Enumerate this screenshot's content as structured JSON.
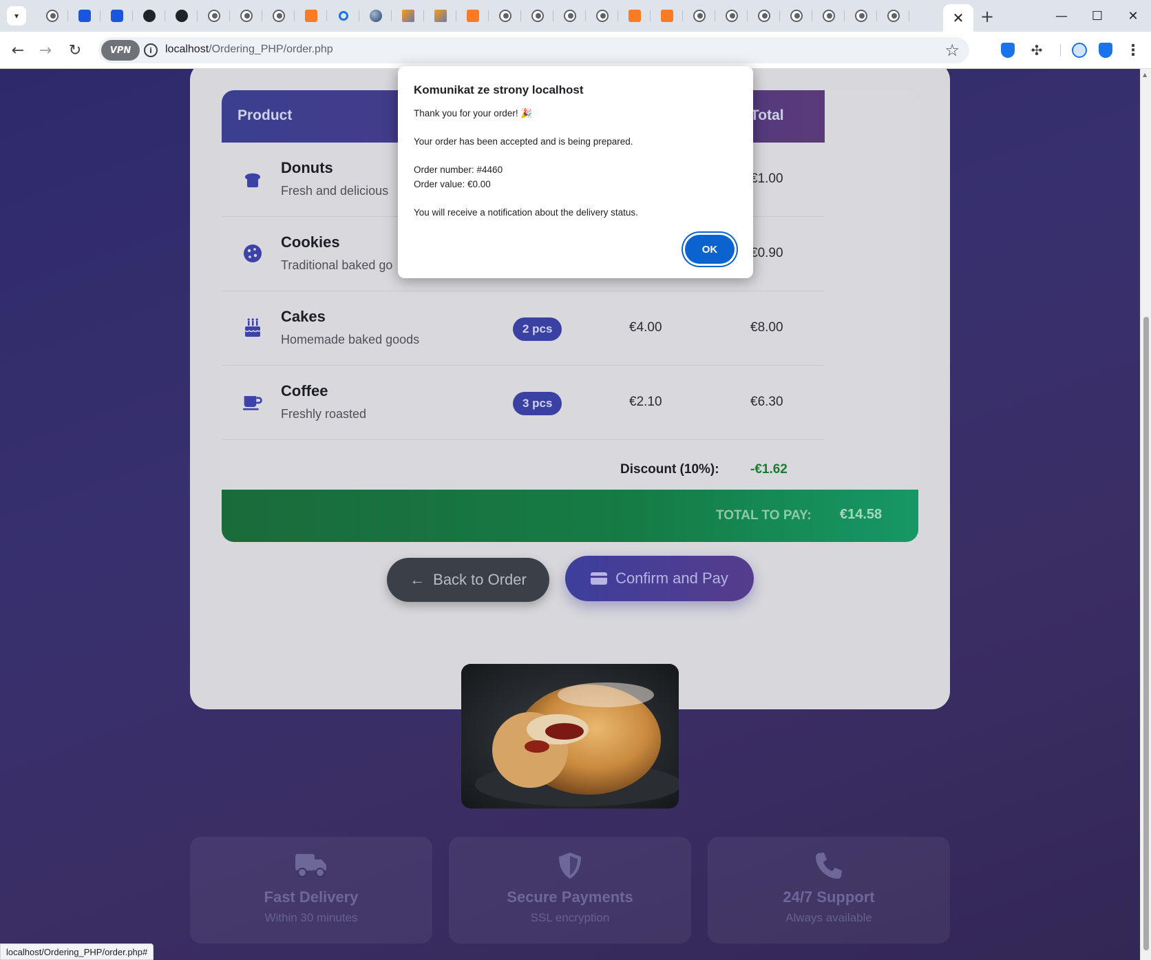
{
  "browser": {
    "url_host": "localhost",
    "url_path": "/Ordering_PHP/order.php",
    "vpn_label": "VPN",
    "status_url": "localhost/Ordering_PHP/order.php#"
  },
  "table": {
    "headers": {
      "product": "Product",
      "total": "Total"
    },
    "rows": [
      {
        "name": "Donuts",
        "desc": "Fresh and delicious",
        "qty": "",
        "price": "",
        "total": "€1.00",
        "icon": "bread-icon"
      },
      {
        "name": "Cookies",
        "desc": "Traditional baked go",
        "qty": "",
        "price": "",
        "total": "€0.90",
        "icon": "cookie-icon"
      },
      {
        "name": "Cakes",
        "desc": "Homemade baked goods",
        "qty": "2 pcs",
        "price": "€4.00",
        "total": "€8.00",
        "icon": "birthday-cake-icon"
      },
      {
        "name": "Coffee",
        "desc": "Freshly roasted",
        "qty": "3 pcs",
        "price": "€2.10",
        "total": "€6.30",
        "icon": "coffee-cup-icon"
      }
    ],
    "discount_label": "Discount (10%):",
    "discount_value": "-€1.62",
    "total_label": "TOTAL TO PAY:",
    "total_value": "€14.58"
  },
  "actions": {
    "back_label": "Back to Order",
    "pay_label": "Confirm and Pay"
  },
  "features": [
    {
      "title": "Fast Delivery",
      "sub": "Within 30 minutes",
      "icon": "truck-icon"
    },
    {
      "title": "Secure Payments",
      "sub": "SSL encryption",
      "icon": "shield-icon"
    },
    {
      "title": "24/7 Support",
      "sub": "Always available",
      "icon": "phone-icon"
    }
  ],
  "dialog": {
    "title": "Komunikat ze strony localhost",
    "line1": "Thank you for your order! 🎉",
    "line2": "Your order has been accepted and is being prepared.",
    "line3": "Order number: #4460",
    "line4": "Order value: €0.00",
    "line5": "You will receive a notification about the delivery status.",
    "ok_label": "OK"
  },
  "colors": {
    "accent": "#3b41a2",
    "total_bar": "#157c46",
    "dialog_button": "#0b63d0"
  }
}
